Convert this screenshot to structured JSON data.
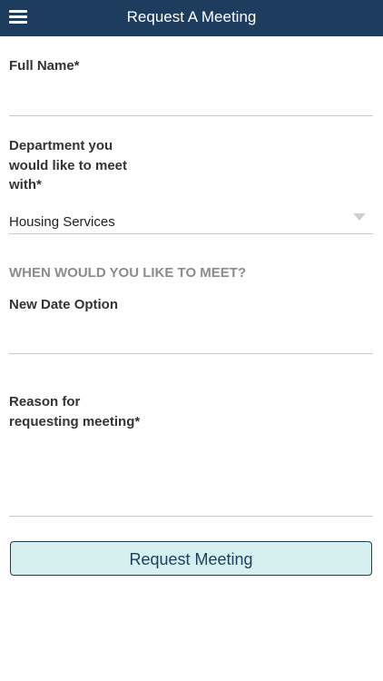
{
  "header": {
    "title": "Request A Meeting",
    "menu_icon": "hamburger-menu-icon",
    "background_color": "#1e3c5e"
  },
  "form": {
    "full_name": {
      "label": "Full Name*",
      "value": ""
    },
    "department": {
      "label_lines": [
        "Department you",
        "would like to meet",
        "with*"
      ],
      "selected": "Housing Services",
      "icon": "dropdown-arrow-icon"
    },
    "schedule_heading": "WHEN WOULD YOU LIKE TO MEET?",
    "new_date": {
      "label": "New Date Option",
      "value": ""
    },
    "reason": {
      "label_lines": [
        "Reason for",
        "requesting meeting*"
      ],
      "value": ""
    },
    "submit_label": "Request Meeting",
    "submit_color": "#d5f0ee"
  }
}
